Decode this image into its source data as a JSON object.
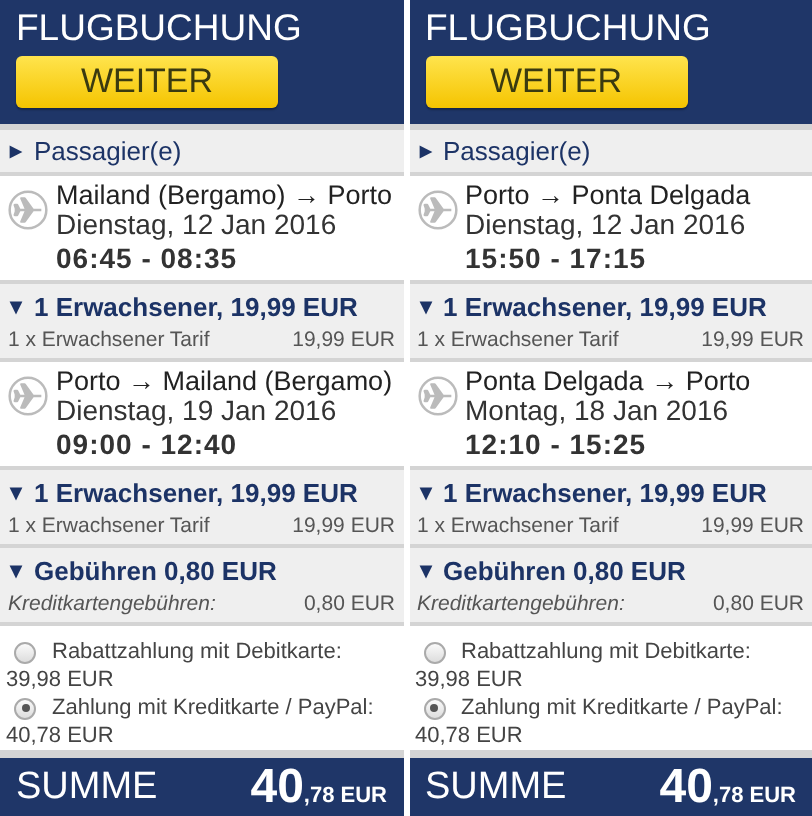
{
  "panels": [
    {
      "title": "FLUGBUCHUNG",
      "button": "WEITER",
      "passengers": {
        "label": "Passagier(e)",
        "expanded": false
      },
      "flights": [
        {
          "route": "Mailand (Bergamo) → Porto",
          "date": "Dienstag, 12 Jan 2016",
          "times": "06:45 - 08:35",
          "fare": {
            "summary": "1 Erwachsener, 19,99 EUR",
            "expanded": true,
            "line_label": "1 x Erwachsener Tarif",
            "line_price": "19,99 EUR"
          }
        },
        {
          "route": "Porto → Mailand (Bergamo)",
          "date": "Dienstag, 19 Jan 2016",
          "times": "09:00 - 12:40",
          "fare": {
            "summary": "1 Erwachsener, 19,99 EUR",
            "expanded": true,
            "line_label": "1 x Erwachsener Tarif",
            "line_price": "19,99 EUR"
          }
        }
      ],
      "fees": {
        "summary": "Gebühren 0,80 EUR",
        "expanded": true,
        "label": "Kreditkartengebühren:",
        "price": "0,80 EUR"
      },
      "payment_options": [
        {
          "label": "Rabattzahlung mit Debitkarte:",
          "price": "39,98 EUR",
          "selected": false
        },
        {
          "label": "Zahlung mit Kreditkarte / PayPal:",
          "price": "40,78 EUR",
          "selected": true
        }
      ],
      "total": {
        "label": "SUMME",
        "integer": "40",
        "decimals": ",78 EUR"
      }
    },
    {
      "title": "FLUGBUCHUNG",
      "button": "WEITER",
      "passengers": {
        "label": "Passagier(e)",
        "expanded": false
      },
      "flights": [
        {
          "route": "Porto → Ponta Delgada",
          "date": "Dienstag, 12 Jan 2016",
          "times": "15:50 - 17:15",
          "fare": {
            "summary": "1 Erwachsener, 19,99 EUR",
            "expanded": true,
            "line_label": "1 x Erwachsener Tarif",
            "line_price": "19,99 EUR"
          }
        },
        {
          "route": "Ponta Delgada → Porto",
          "date": "Montag, 18 Jan 2016",
          "times": "12:10 - 15:25",
          "fare": {
            "summary": "1 Erwachsener, 19,99 EUR",
            "expanded": true,
            "line_label": "1 x Erwachsener Tarif",
            "line_price": "19,99 EUR"
          }
        }
      ],
      "fees": {
        "summary": "Gebühren 0,80 EUR",
        "expanded": true,
        "label": "Kreditkartengebühren:",
        "price": "0,80 EUR"
      },
      "payment_options": [
        {
          "label": "Rabattzahlung mit Debitkarte:",
          "price": "39,98 EUR",
          "selected": false
        },
        {
          "label": "Zahlung mit Kreditkarte / PayPal:",
          "price": "40,78 EUR",
          "selected": true
        }
      ],
      "total": {
        "label": "SUMME",
        "integer": "40",
        "decimals": ",78 EUR"
      }
    }
  ]
}
